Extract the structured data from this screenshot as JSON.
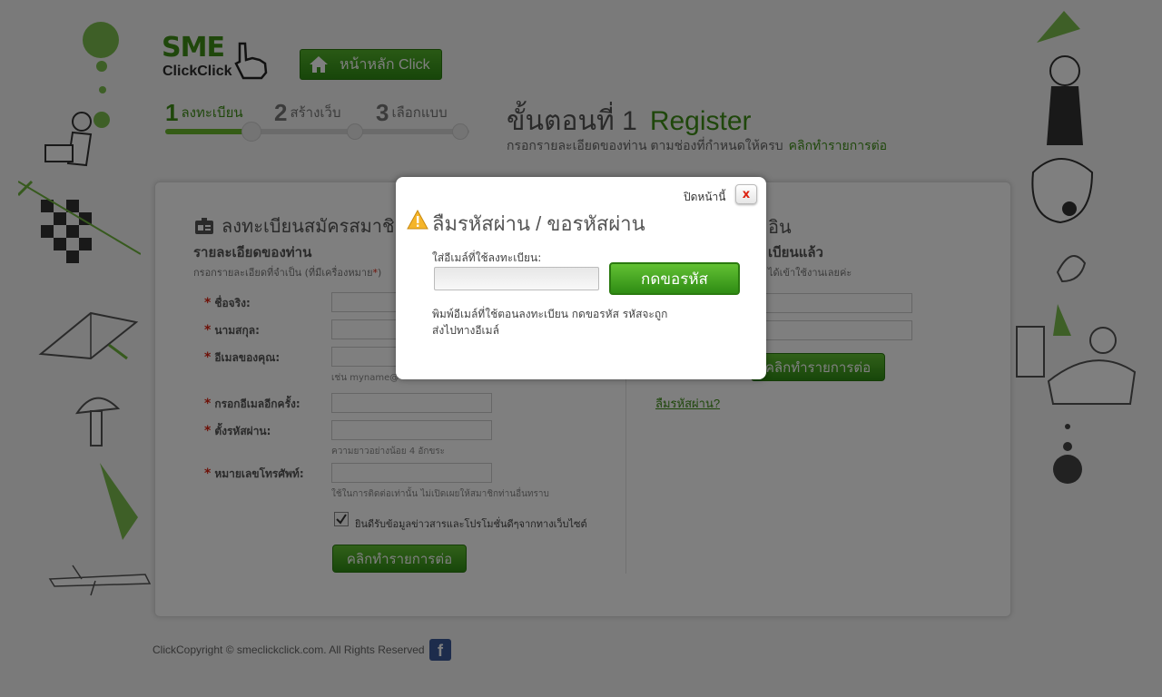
{
  "brand": {
    "logo_main": "SME",
    "logo_sub": "ClickClick"
  },
  "header": {
    "home_label": "หน้าหลัก Click"
  },
  "steps": {
    "items": [
      {
        "num": "1",
        "label": "ลงทะเบียน"
      },
      {
        "num": "2",
        "label": "สร้างเว็บ"
      },
      {
        "num": "3",
        "label": "เลือกแบบ"
      }
    ],
    "current": 1,
    "title_prefix": "ขั้นตอนที่ 1",
    "title_main": "Register",
    "subtitle": "กรอกรายละเอียดของท่าน ตามช่องที่กำหนดให้ครบ",
    "subtitle_link": "คลิกทำรายการต่อ"
  },
  "register": {
    "title": "ลงทะเบียนสมัครสมาชิก",
    "subtitle": "รายละเอียดของท่าน",
    "note": "กรอกรายละเอียดที่จำเป็น (ที่มีเครื่องหมาย",
    "note_star": "*",
    "note_end": ")",
    "fields": [
      {
        "label": "ชื่อจริง:",
        "hint": ""
      },
      {
        "label": "นามสกุล:",
        "hint": ""
      },
      {
        "label": "อีเมลของคุณ:",
        "hint": "เช่น myname@"
      },
      {
        "label": "กรอกอีเมลอีกครั้ง:",
        "hint": ""
      },
      {
        "label": "ตั้งรหัสผ่าน:",
        "hint": "ความยาวอย่างน้อย 4 อักขระ"
      },
      {
        "label": "หมายเลขโทรศัพท์:",
        "hint": "ใช้ในการติดต่อเท่านั้น ไม่เปิดเผยให้สมาชิกท่านอื่นทราบ"
      }
    ],
    "consent_label": "ยินดีรับข้อมูลข่าวสารและโปรโมชั่นดีๆจากทางเว็บไซต์",
    "consent_checked": true,
    "submit_label": "คลิกทำรายการต่อ"
  },
  "login": {
    "title_partial": "อิน",
    "subtitle_partial": "เบียนแล้ว",
    "note_partial": "ได้เข้าใช้งานเลยค่ะ",
    "submit_label": "คลิกทำรายการต่อ",
    "forgot_label": "ลืมรหัสผ่าน?"
  },
  "footer": {
    "copyright": "ClickCopyright © smeclickclick.com. All Rights Reserved",
    "facebook": "f"
  },
  "modal": {
    "close_label": "ปิดหน้านี้",
    "close_x": "x",
    "title": "ลืมรหัสผ่าน / ขอรหัสผ่าน",
    "email_label": "ใส่อีเมล์ที่ใช้ลงทะเบียน:",
    "submit_label": "กดขอรหัส",
    "note": "พิมพ์อีเมล์ที่ใช้ตอนลงทะเบียน กดขอรหัส รหัสจะถูกส่งไปทางอีเมล์"
  },
  "colors": {
    "brand_green": "#3f8f17",
    "required_red": "#dd2211",
    "overlay": "rgba(0,0,0,0.5)"
  }
}
